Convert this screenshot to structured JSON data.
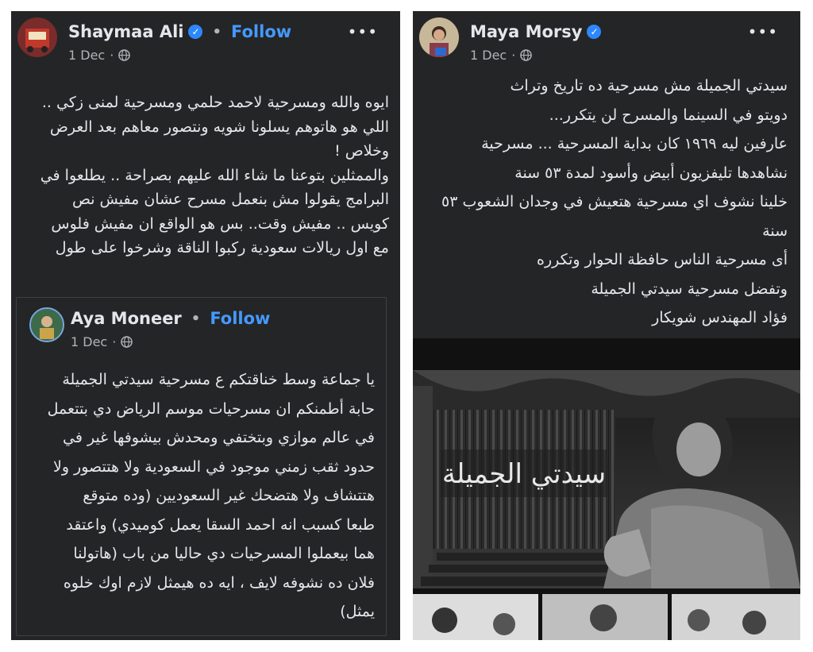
{
  "left_post": {
    "author": "Shaymaa Ali",
    "follow": "Follow",
    "date": "1 Dec",
    "more": "•••",
    "lines": [
      "ايوه والله ومسرحية لاحمد حلمي ومسرحية لمنى زكي ..",
      "اللي هو هاتوهم يسلونا شويه ونتصور معاهم بعد العرض",
      "وخلاص !",
      "والممثلين بتوعنا ما شاء الله عليهم بصراحة .. يطلعوا في",
      "البرامج يقولوا مش بنعمل مسرح عشان مفيش نص",
      "كويس .. مفيش وقت..   بس هو الواقع ان مفيش فلوس",
      "مع اول ريالات سعودية ركبوا الناقة وشرخوا على طول"
    ],
    "shared_post": {
      "author": "Aya Moneer",
      "follow": "Follow",
      "date": "1 Dec",
      "lines": [
        "يا جماعة وسط خناقتكم ع مسرحية سيدتي الجميلة",
        "حابة أطمنكم ان مسرحيات موسم الرياض دي بتتعمل",
        "في عالم موازي وبتختفي ومحدش بيشوفها غير في",
        "حدود ثقب زمني موجود في السعودية ولا هتتصور ولا",
        "هتتشاف ولا هتضحك غير السعوديين (وده متوقع",
        "طبعا كسبب انه احمد السقا يعمل كوميدي) واعتقد",
        "هما بيعملوا المسرحيات دي حاليا من باب (هاتولنا",
        "فلان ده نشوفه لايف ، ايه ده هيمثل لازم اوك خلوه",
        "يمثل)"
      ]
    }
  },
  "right_post": {
    "author": "Maya Morsy",
    "date": "1 Dec",
    "more": "•••",
    "lines": [
      "سيدتي الجميلة مش مسرحية ده تاريخ وتراث",
      "دويتو في السينما والمسرح لن يتكرر...",
      "عارفين ليه ١٩٦٩ كان بداية المسرحية ... مسرحية",
      "نشاهدها تليفزيون أبيض وأسود لمدة ٥٣ سنة",
      "خلينا نشوف اي مسرحية هتعيش في وجدان الشعوب ٥٣",
      "سنة",
      "أى مسرحية الناس حافظة الحوار وتكرره",
      "وتفضل مسرحية سيدتي الجميلة",
      "فؤاد المهندس شويكار"
    ],
    "photo_title": "سيدتي الجميلة"
  },
  "colors": {
    "panel_bg": "#242526",
    "text": "#e4e6eb",
    "muted": "#b0b3b8",
    "follow": "#4599ff",
    "verified": "#2d88ff"
  },
  "icons": [
    "verified-badge-icon",
    "globe-icon",
    "more-options-icon"
  ]
}
